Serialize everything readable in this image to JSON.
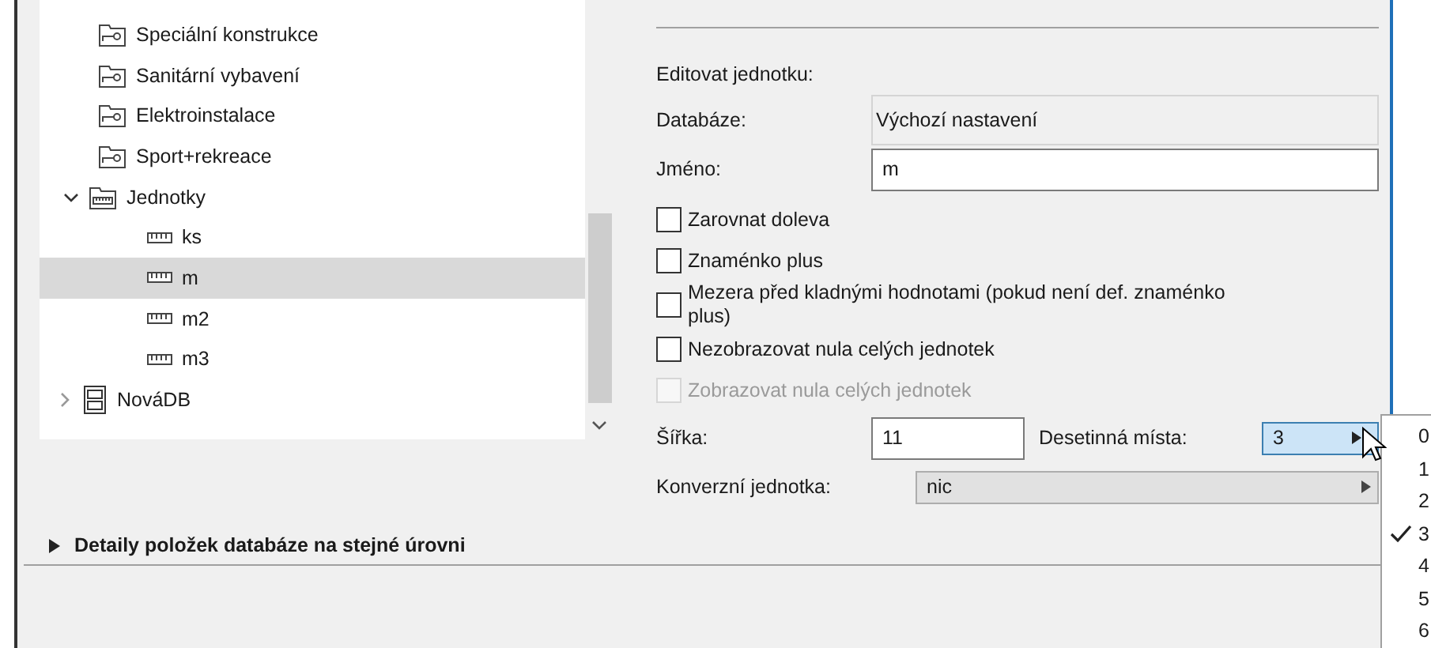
{
  "tree": {
    "items": [
      {
        "label": "Speciální konstrukce",
        "kind": "category",
        "selected": false
      },
      {
        "label": "Sanitární vybavení",
        "kind": "category",
        "selected": false
      },
      {
        "label": "Elektroinstalace",
        "kind": "category",
        "selected": false
      },
      {
        "label": "Sport+rekreace",
        "kind": "category",
        "selected": false
      },
      {
        "label": "Jednotky",
        "kind": "units",
        "expanded": true,
        "selected": false,
        "children": [
          {
            "label": "ks",
            "kind": "unit",
            "selected": false
          },
          {
            "label": "m",
            "kind": "unit",
            "selected": true
          },
          {
            "label": "m2",
            "kind": "unit",
            "selected": false
          },
          {
            "label": "m3",
            "kind": "unit",
            "selected": false
          }
        ]
      },
      {
        "label": "NováDB",
        "kind": "database",
        "expanded": false,
        "selected": false
      }
    ]
  },
  "form": {
    "heading": "Editovat jednotku:",
    "database": {
      "label": "Databáze:",
      "value": "Výchozí nastavení"
    },
    "name": {
      "label": "Jméno:",
      "value": "m"
    },
    "checkboxes": [
      {
        "label": "Zarovnat doleva",
        "checked": false,
        "disabled": false
      },
      {
        "label": "Znaménko plus",
        "checked": false,
        "disabled": false
      },
      {
        "label": "Mezera před kladnými hodnotami (pokud není def. znaménko plus)",
        "checked": false,
        "disabled": false
      },
      {
        "label": "Nezobrazovat nula celých jednotek",
        "checked": false,
        "disabled": false
      },
      {
        "label": "Zobrazovat nula celých jednotek",
        "checked": false,
        "disabled": true
      }
    ],
    "width": {
      "label": "Šířka:",
      "value": "11"
    },
    "decimals": {
      "label": "Desetinná místa:",
      "value": "3",
      "open": true,
      "options": [
        {
          "label": "0",
          "selected": false
        },
        {
          "label": "1",
          "selected": false
        },
        {
          "label": "2",
          "selected": false
        },
        {
          "label": "3",
          "selected": true
        },
        {
          "label": "4",
          "selected": false
        },
        {
          "label": "5",
          "selected": false
        },
        {
          "label": "6",
          "selected": false
        }
      ]
    },
    "conversion": {
      "label": "Konverzní jednotka:",
      "value": "nic"
    }
  },
  "details": {
    "label": "Detaily položek databáze na stejné úrovni",
    "expanded": false
  }
}
